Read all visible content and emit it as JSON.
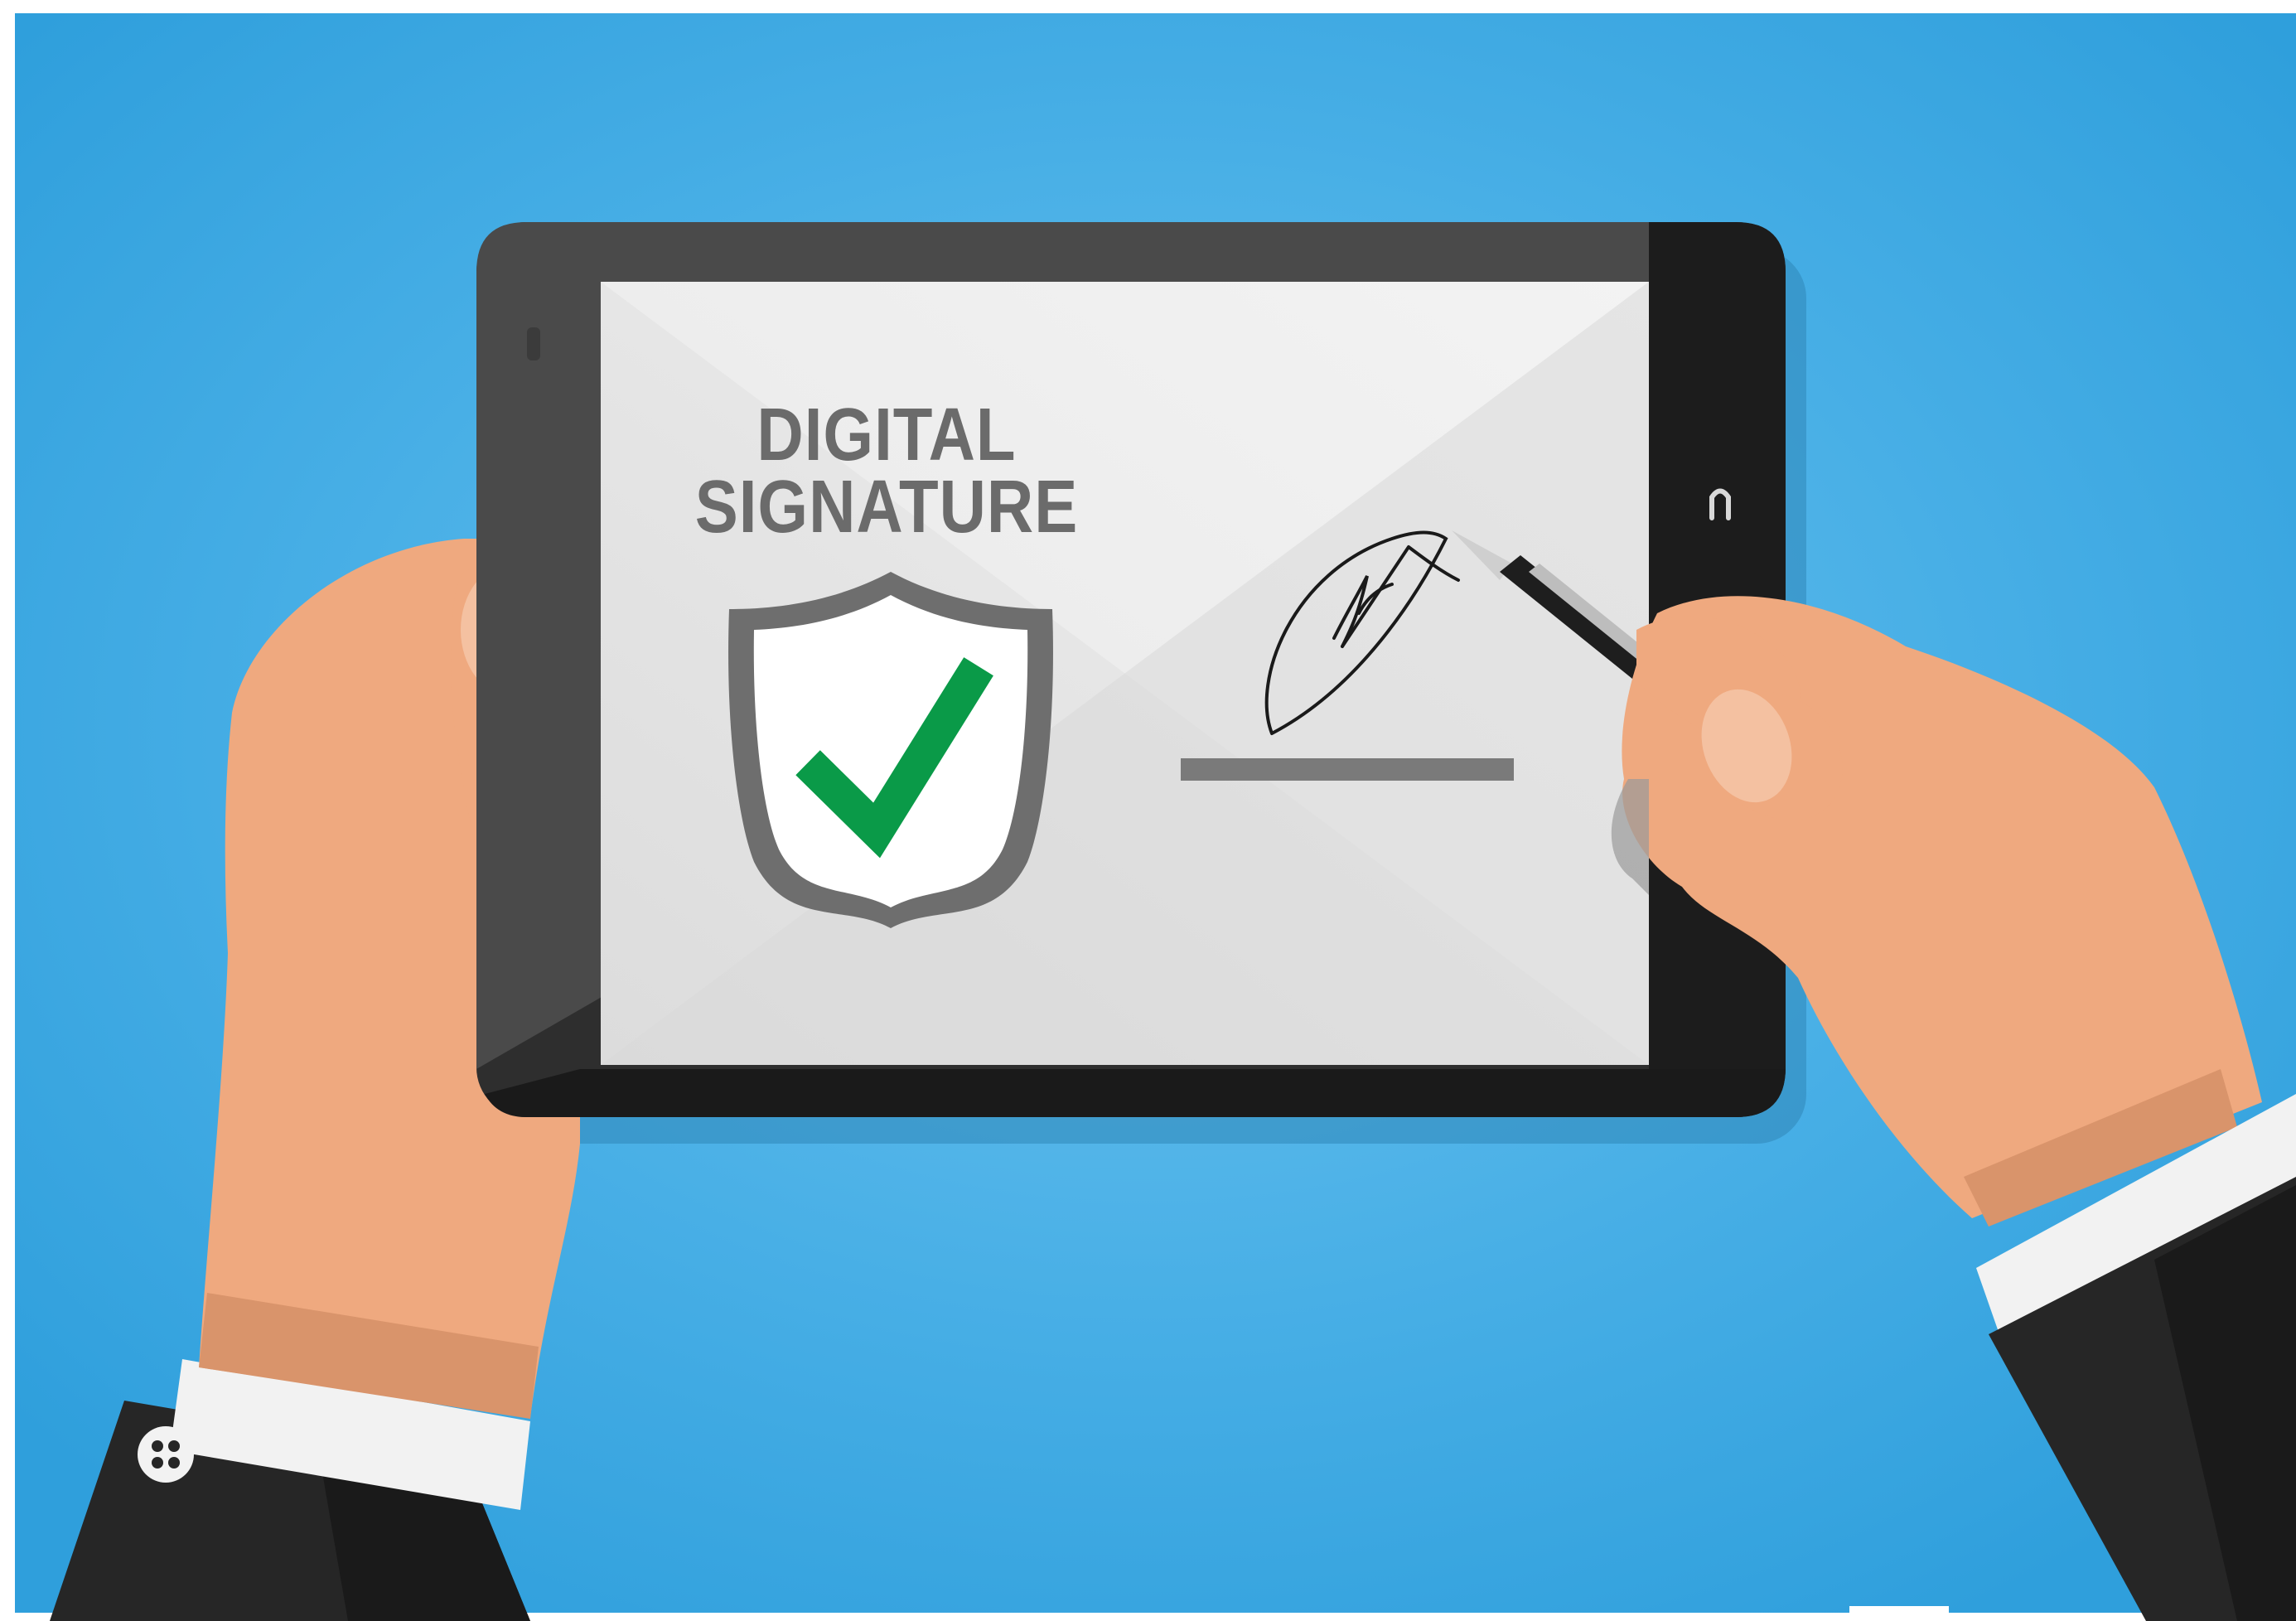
{
  "illustration": {
    "headline": {
      "line1": "DIGITAL",
      "line2": "SIGNATURE"
    },
    "icons": {
      "shield": "shield-check-icon",
      "pen": "pen-icon",
      "back_button": "back-button-icon",
      "camera": "camera-icon",
      "cufflink": "cufflink-icon"
    },
    "colors": {
      "background": "#3aa6e0",
      "tablet_body": "#2e2e2e",
      "screen": "#ececec",
      "shield_outline": "#6e6e6e",
      "checkmark": "#0a9a48",
      "skin": "#efa97f",
      "sleeve": "#262626",
      "cuff": "#f2f2f2"
    }
  }
}
